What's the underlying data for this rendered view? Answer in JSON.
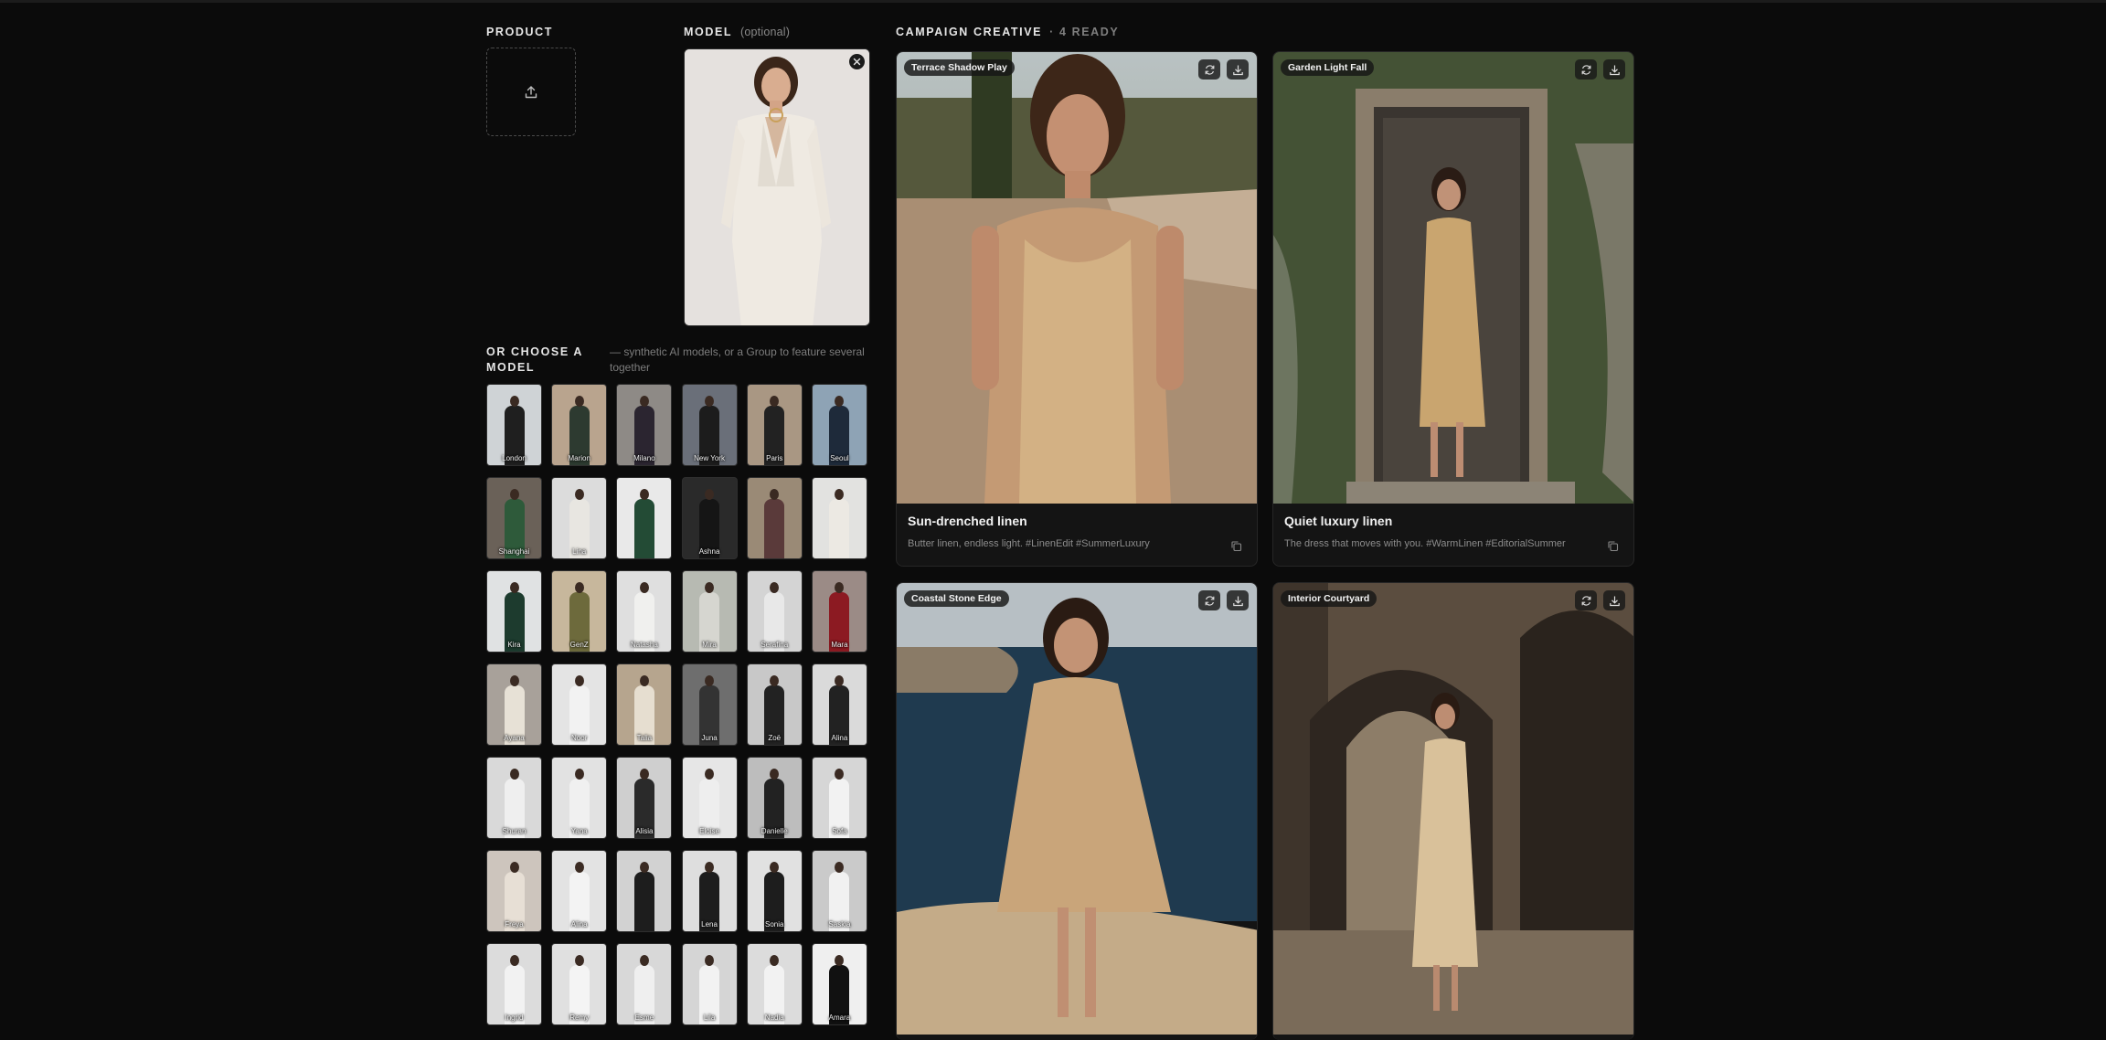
{
  "product": {
    "label": "PRODUCT",
    "upload_icon": "upload-icon"
  },
  "model": {
    "label": "MODEL",
    "optional": "(optional)",
    "close_icon": "close-icon"
  },
  "chooser": {
    "title": "OR CHOOSE A MODEL",
    "subtitle": "— synthetic AI models, or a Group to feature several together",
    "models": [
      "London",
      "Marion",
      "Milano",
      "New York",
      "Paris",
      "Seoul",
      "Shanghai",
      "Lina",
      "",
      "Ashna",
      "",
      "",
      "Kira",
      "GenZ",
      "Natasha",
      "Mira",
      "Serafina",
      "Mara",
      "Ayana",
      "Noor",
      "Talia",
      "Juna",
      "Zoë",
      "Alina",
      "Shuran",
      "Yana",
      "Alisia",
      "Eloise",
      "Danielle",
      "Sofa",
      "Freya",
      "Alina",
      "",
      "Lena",
      "Sonia",
      "Saskia",
      "Ingrid",
      "Remy",
      "Esme",
      "Lila",
      "Nadia",
      "Amara"
    ]
  },
  "creative": {
    "label": "CAMPAIGN CREATIVE",
    "status": "· 4 READY",
    "cards": [
      {
        "chip": "Terrace Shadow Play",
        "title": "Sun-drenched linen",
        "caption": "Butter linen, endless light. #LinenEdit #SummerLuxury"
      },
      {
        "chip": "Garden Light Fall",
        "title": "Quiet luxury linen",
        "caption": "The dress that moves with you. #WarmLinen #EditorialSummer"
      },
      {
        "chip": "Coastal Stone Edge",
        "title": "",
        "caption": ""
      },
      {
        "chip": "Interior Courtyard",
        "title": "",
        "caption": ""
      }
    ],
    "icons": {
      "regenerate": "refresh-icon",
      "download": "download-icon",
      "copy": "copy-icon"
    }
  },
  "colors": {
    "background": "#0b0b0b",
    "card": "#141414",
    "accent_text": "#e6e6e6",
    "muted": "#8a8a8a"
  }
}
